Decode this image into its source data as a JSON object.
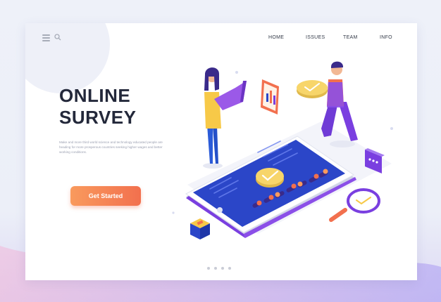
{
  "nav": {
    "menu_icon": "hamburger-menu-icon",
    "search_icon": "search-icon",
    "links": [
      "HOME",
      "ISSUES",
      "TEAM",
      "INFO"
    ]
  },
  "hero": {
    "title_line1": "ONLINE",
    "title_line2": "SURVEY",
    "description": "Make and more third world science and technology educated people are heading for more prosperous countries seeking higher wages and better working conditions.",
    "cta_label": "Get Started"
  },
  "colors": {
    "accent_orange": "#f2704e",
    "accent_purple": "#7a3fe0",
    "screen_blue": "#2b46c8",
    "check_yellow": "#f7d56a"
  },
  "carousel": {
    "dot_count": 4
  }
}
